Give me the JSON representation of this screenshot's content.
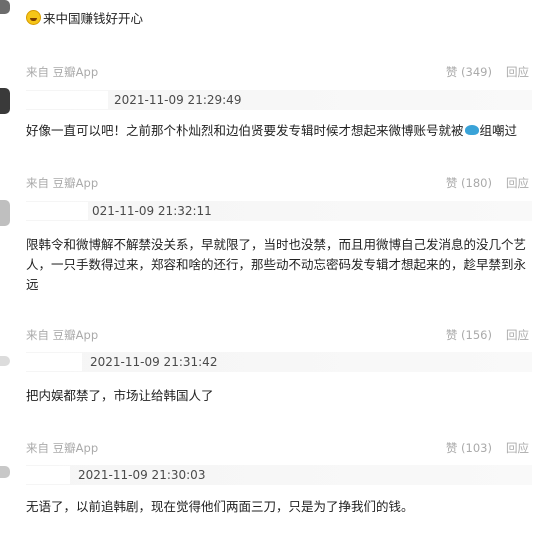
{
  "first_comment": {
    "text": "来中国赚钱好开心"
  },
  "comments": [
    {
      "source": "来自 豆瓣App",
      "likes": "赞 (349)",
      "reply": "回应",
      "time": "2021-11-09 21:29:49",
      "text_before_icon": "好像一直可以吧！之前那个朴灿烈和边伯贤要发专辑时候才想起来微博账号就被",
      "text_after_icon": "组嘲过"
    },
    {
      "source": "来自 豆瓣App",
      "likes": "赞 (180)",
      "reply": "回应",
      "time": "021-11-09 21:32:11",
      "text": "限韩令和微博解不解禁没关系，早就限了，当时也没禁，而且用微博自己发消息的没几个艺人，一只手数得过来，郑容和啥的还行，那些动不动忘密码发专辑才想起来的，趁早禁到永远"
    },
    {
      "source": "来自 豆瓣App",
      "likes": "赞 (156)",
      "reply": "回应",
      "time": "2021-11-09 21:31:42",
      "text": "把内娱都禁了，市场让给韩国人了"
    },
    {
      "source": "来自 豆瓣App",
      "likes": "赞 (103)",
      "reply": "回应",
      "time": "2021-11-09 21:30:03",
      "text": "无语了，以前追韩剧，现在觉得他们两面三刀，只是为了挣我们的钱。"
    }
  ],
  "icons": {
    "emoji": "grinning-face-emoji",
    "inline": "dolphin-emoji",
    "avatar": "user-avatar"
  }
}
